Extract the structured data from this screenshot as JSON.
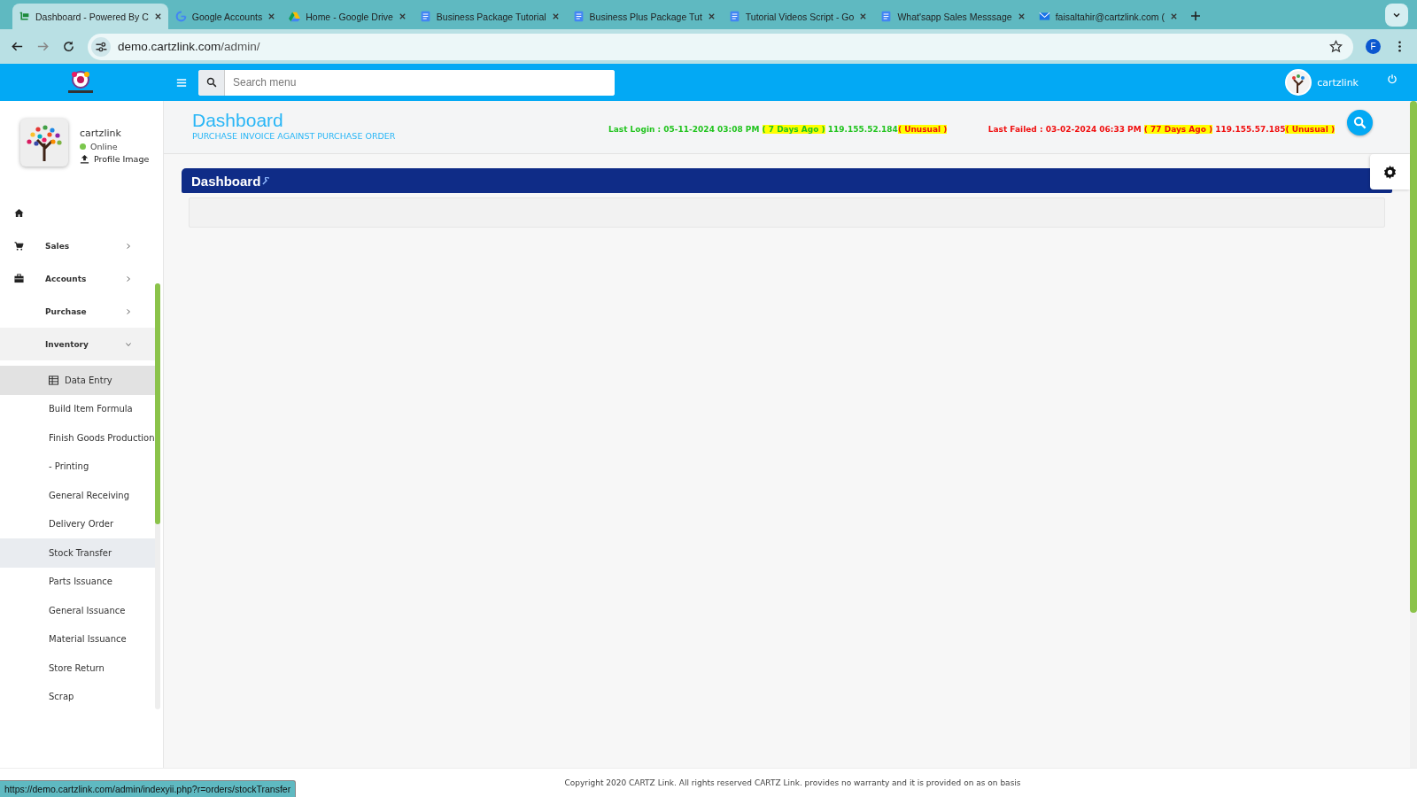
{
  "browser": {
    "tabs": [
      {
        "title": "Dashboard - Powered By C",
        "kind": "cart",
        "selected": true
      },
      {
        "title": "Google Accounts",
        "kind": "google",
        "selected": false
      },
      {
        "title": "Home - Google Drive",
        "kind": "drive",
        "selected": false
      },
      {
        "title": "Business Package Tutorial",
        "kind": "doc",
        "selected": false
      },
      {
        "title": "Business Plus Package Tut",
        "kind": "doc",
        "selected": false
      },
      {
        "title": "Tutorial Videos Script - Go",
        "kind": "doc",
        "selected": false
      },
      {
        "title": "What'sapp Sales Messsage",
        "kind": "doc",
        "selected": false
      },
      {
        "title": "faisaltahir@cartzlink.com (",
        "kind": "mail",
        "selected": false
      }
    ],
    "address": {
      "host": "demo.cartzlink.com",
      "path": "/admin/"
    },
    "profile_initial": "F",
    "status_url": "https://demo.cartzlink.com/admin/indexyii.php?r=orders/stockTransfer"
  },
  "header": {
    "search": {
      "placeholder": "Search menu"
    },
    "user": "cartzlink"
  },
  "sidebar": {
    "profile": {
      "name": "cartzlink",
      "status": "Online",
      "online": true,
      "upload": "Profile Image"
    },
    "items": [
      {
        "kind": "home",
        "expanded": false
      },
      {
        "kind": "sales",
        "label": "Sales",
        "expanded": false
      },
      {
        "kind": "accounts",
        "label": "Accounts",
        "expanded": false
      },
      {
        "kind": "plain",
        "label": "Purchase",
        "expanded": false
      },
      {
        "kind": "plain",
        "label": "Inventory",
        "expanded": true,
        "children": [
          {
            "label": "Data Entry",
            "icon": true,
            "selected": true,
            "hovered": false
          },
          {
            "label": "Build Item Formula",
            "icon": false,
            "selected": false,
            "hovered": false
          },
          {
            "label": "Finish Goods Production",
            "icon": false,
            "selected": false,
            "hovered": false
          },
          {
            "label": "- Printing",
            "icon": false,
            "selected": false,
            "hovered": false
          },
          {
            "label": "General Receiving",
            "icon": false,
            "selected": false,
            "hovered": false
          },
          {
            "label": "Delivery Order",
            "icon": false,
            "selected": false,
            "hovered": false
          },
          {
            "label": "Stock Transfer",
            "icon": false,
            "selected": false,
            "hovered": true
          },
          {
            "label": "Parts Issuance",
            "icon": false,
            "selected": false,
            "hovered": false
          },
          {
            "label": "General Issuance",
            "icon": false,
            "selected": false,
            "hovered": false
          },
          {
            "label": "Material Issuance",
            "icon": false,
            "selected": false,
            "hovered": false
          },
          {
            "label": "Store Return",
            "icon": false,
            "selected": false,
            "hovered": false
          },
          {
            "label": "Scrap",
            "icon": false,
            "selected": false,
            "hovered": false
          }
        ]
      }
    ]
  },
  "page": {
    "title": "Dashboard",
    "subtitle": "PURCHASE INVOICE AGAINST PURCHASE ORDER",
    "logins": [
      {
        "kind": "success",
        "label": "Last Login : 05-11-2024 03:08 PM",
        "ago": "( 7 Days Ago )",
        "ip": "119.155.52.184",
        "flag": "( Unusual )"
      },
      {
        "kind": "failed",
        "label": "Last Failed : 03-02-2024 06:33 PM",
        "ago": "( 77 Days Ago )",
        "ip": "119.155.57.185",
        "flag": "( Unusual )"
      }
    ],
    "panel_title": "Dashboard"
  },
  "footer": "Copyright 2020 CARTZ Link. All rights reserved CARTZ Link. provides no warranty and it is provided on as on basis"
}
